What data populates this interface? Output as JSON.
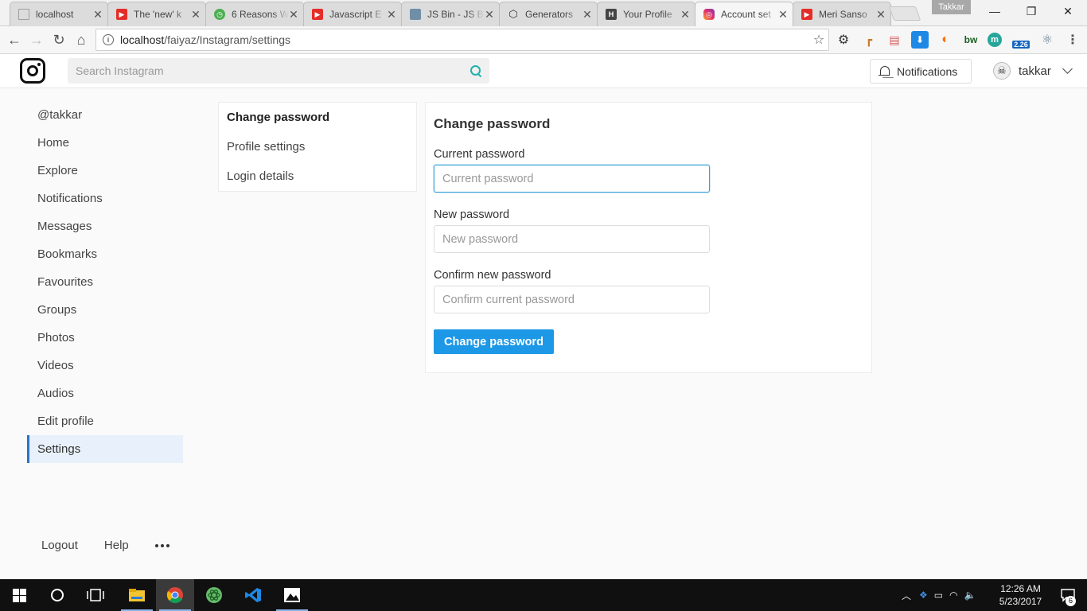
{
  "browser": {
    "tabs": [
      {
        "title": "localhost",
        "favicon": "page-icon",
        "favicon_color": "#9e9e9e"
      },
      {
        "title": "The 'new' k",
        "favicon": "youtube-icon",
        "favicon_color": "#e52d27"
      },
      {
        "title": "6 Reasons W",
        "favicon": "clock-icon",
        "favicon_color": "#4caf50"
      },
      {
        "title": "Javascript E",
        "favicon": "youtube-icon",
        "favicon_color": "#e52d27"
      },
      {
        "title": "JS Bin - JS B",
        "favicon": "jsbin-icon",
        "favicon_color": "#6f8fa8"
      },
      {
        "title": "Generators",
        "favicon": "codepen-icon",
        "favicon_color": "#333333"
      },
      {
        "title": "Your Profile",
        "favicon": "h-icon",
        "favicon_color": "#444444"
      },
      {
        "title": "Account set",
        "favicon": "instagram-icon",
        "favicon_color": "#c13584",
        "active": true
      },
      {
        "title": "Meri Sanso",
        "favicon": "youtube-icon",
        "favicon_color": "#e52d27"
      }
    ],
    "profile_name": "Takkar",
    "url": "localhost/faiyaz/Instagram/settings",
    "url_host": "localhost",
    "url_path": "/faiyaz/Instagram/settings",
    "extensions": [
      {
        "name": "gear-extension-icon",
        "glyph": "⚙",
        "color": "#333333"
      },
      {
        "name": "ruler-extension-icon",
        "glyph": "┏",
        "color": "#c97a2b"
      },
      {
        "name": "window-extension-icon",
        "glyph": "▤",
        "color": "#d9534f"
      },
      {
        "name": "download-extension-icon",
        "glyph": "⬇",
        "color": "#1e88e5"
      },
      {
        "name": "orb-extension-icon",
        "glyph": "◐",
        "color": "#ff6d00"
      },
      {
        "name": "bw-extension-icon",
        "glyph": "bw",
        "color": "#1b5e20"
      },
      {
        "name": "m-extension-icon",
        "glyph": "m",
        "color": "#26a69a"
      },
      {
        "name": "speed-extension-icon",
        "glyph": "2.26",
        "color": "#1565c0"
      },
      {
        "name": "react-extension-icon",
        "glyph": "⚛",
        "color": "#607d8b"
      }
    ]
  },
  "header": {
    "search_placeholder": "Search Instagram",
    "notifications_label": "Notifications",
    "username": "takkar",
    "avatar_glyph": "☠"
  },
  "sidebar": {
    "items": [
      {
        "label": "@takkar"
      },
      {
        "label": "Home"
      },
      {
        "label": "Explore"
      },
      {
        "label": "Notifications"
      },
      {
        "label": "Messages"
      },
      {
        "label": "Bookmarks"
      },
      {
        "label": "Favourites"
      },
      {
        "label": "Groups"
      },
      {
        "label": "Photos"
      },
      {
        "label": "Videos"
      },
      {
        "label": "Audios"
      },
      {
        "label": "Edit profile"
      },
      {
        "label": "Settings",
        "active": true
      }
    ],
    "footer": {
      "logout": "Logout",
      "help": "Help"
    }
  },
  "settings_nav": {
    "items": [
      {
        "label": "Change password",
        "active": true
      },
      {
        "label": "Profile settings"
      },
      {
        "label": "Login details"
      }
    ]
  },
  "form": {
    "title": "Change password",
    "current": {
      "label": "Current password",
      "placeholder": "Current password",
      "value": ""
    },
    "new": {
      "label": "New password",
      "placeholder": "New password",
      "value": ""
    },
    "confirm": {
      "label": "Confirm new password",
      "placeholder": "Confirm current password",
      "value": ""
    },
    "submit_label": "Change password"
  },
  "taskbar": {
    "time": "12:26 AM",
    "date": "5/23/2017",
    "notification_count": "6"
  },
  "colors": {
    "accent": "#1d98e6",
    "sidebar_active_bg": "#e8f1fb",
    "sidebar_active_border": "#2a73c9"
  }
}
